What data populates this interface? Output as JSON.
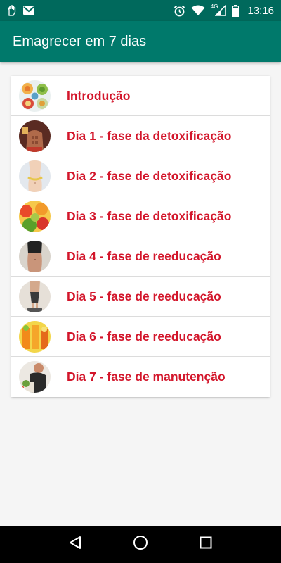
{
  "status_bar": {
    "time": "13:16",
    "network_label": "4G",
    "left_icons": [
      "hand-notification-icon",
      "gmail-icon"
    ],
    "right_icons": [
      "alarm-icon",
      "wifi-icon",
      "signal-icon",
      "battery-icon"
    ]
  },
  "app_bar": {
    "title": "Emagrecer em 7 dias",
    "color": "#00796b"
  },
  "list": {
    "label_color": "#d3162b",
    "items": [
      {
        "label": "Introdução",
        "image": "healthy-food-plates"
      },
      {
        "label": "Dia 1 - fase da detoxificação",
        "image": "muscular-torso"
      },
      {
        "label": "Dia 2 - fase de detoxificação",
        "image": "measuring-waist"
      },
      {
        "label": "Dia 3 - fase de detoxificação",
        "image": "fruits-vegetables"
      },
      {
        "label": "Dia 4 - fase de reeducação",
        "image": "woman-waist"
      },
      {
        "label": "Dia 5 - fase de reeducação",
        "image": "woman-on-scale"
      },
      {
        "label": "Dia 6 - fase de reeducação",
        "image": "juice-glasses"
      },
      {
        "label": "Dia 7 - fase de manutenção",
        "image": "man-eating"
      }
    ]
  },
  "nav_bar": {
    "buttons": [
      "back-icon",
      "home-icon",
      "recents-icon"
    ]
  }
}
